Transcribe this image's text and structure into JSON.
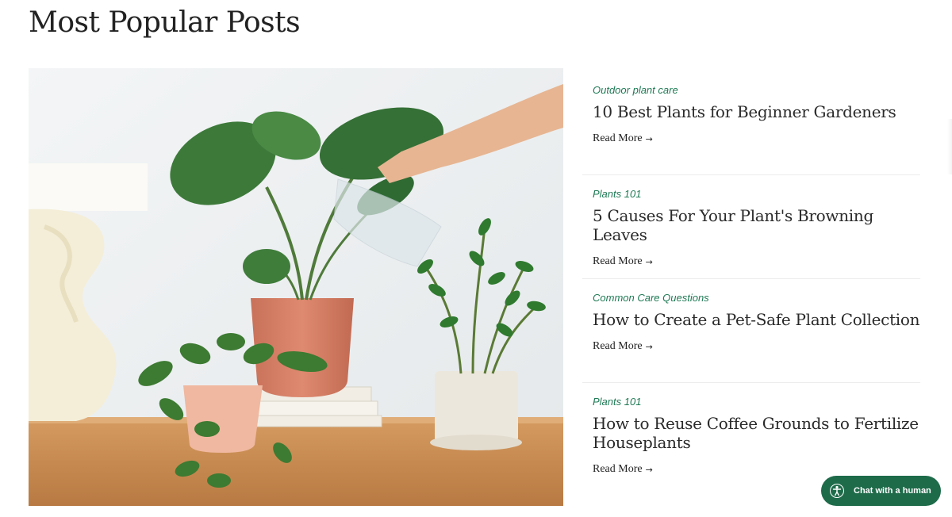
{
  "page": {
    "title": "Most Popular Posts"
  },
  "hero_image": {
    "icon": "plant-watering-photo"
  },
  "posts": [
    {
      "category": "Outdoor plant care",
      "title": "10 Best Plants for Beginner Gardeners",
      "read_more": "Read More",
      "arrow": "→"
    },
    {
      "category": "Plants 101",
      "title": "5 Causes For Your Plant's Browning Leaves",
      "read_more": "Read More",
      "arrow": "→"
    },
    {
      "category": "Common Care Questions",
      "title": "How to Create a Pet-Safe Plant Collection",
      "read_more": "Read More",
      "arrow": "→"
    },
    {
      "category": "Plants 101",
      "title": "How to Reuse Coffee Grounds to Fertilize Houseplants",
      "read_more": "Read More",
      "arrow": "→"
    }
  ],
  "chat": {
    "label": "Chat with a human",
    "icon": "accessibility-icon"
  },
  "colors": {
    "accent": "#1f7a55",
    "chat_bg": "#1e6b4a"
  }
}
